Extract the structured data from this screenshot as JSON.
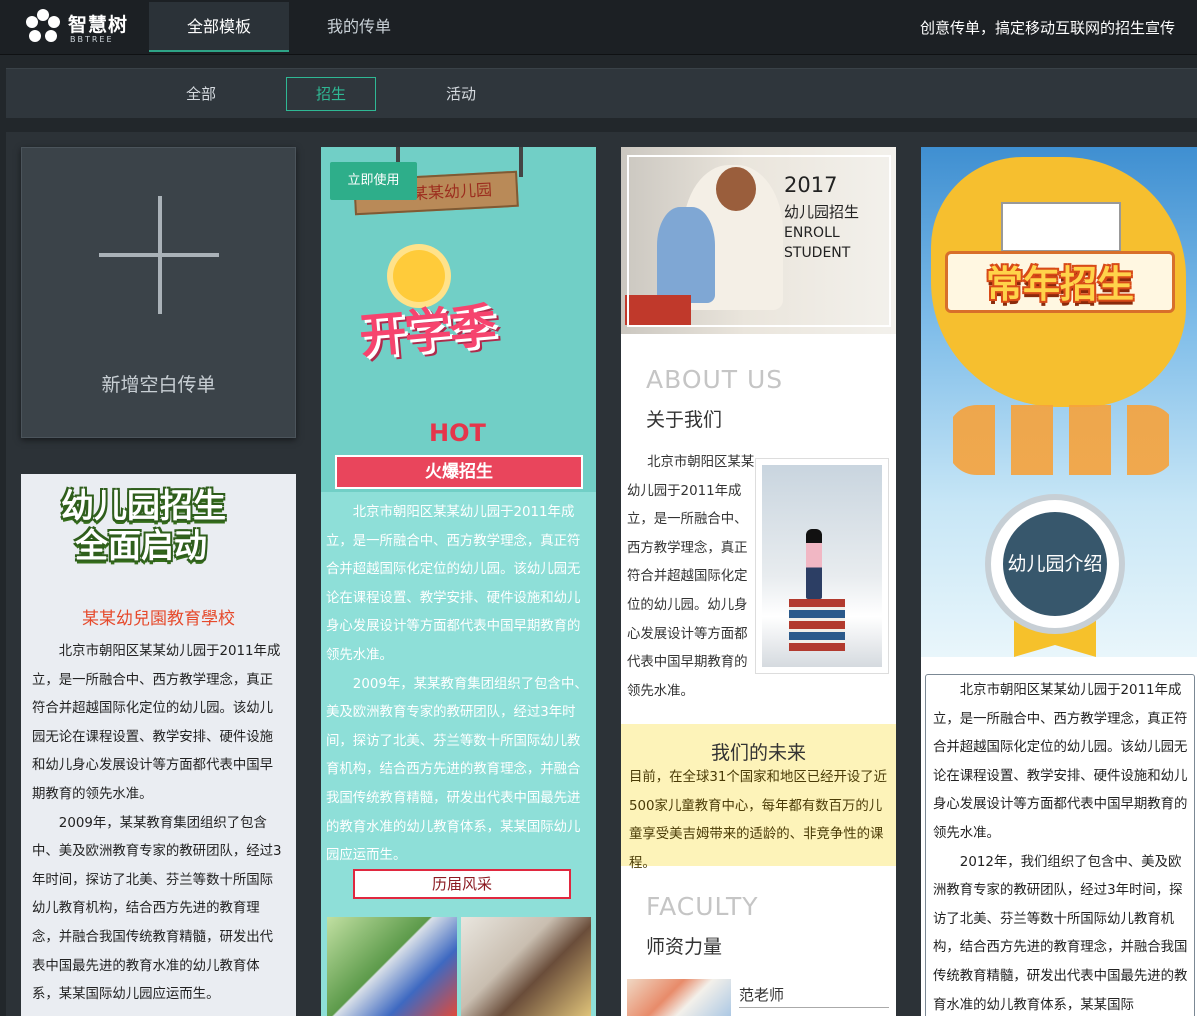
{
  "header": {
    "logo_name": "智慧树",
    "logo_sub": "BBTREE",
    "tabs": [
      "全部模板",
      "我的传单"
    ],
    "slogan": "创意传单，搞定移动互联网的招生宣传"
  },
  "filters": [
    "全部",
    "招生",
    "活动"
  ],
  "new_card": {
    "label": "新增空白传单"
  },
  "card1": {
    "banner_line1": "幼儿园招生",
    "banner_line2": "全面启动",
    "school": "某某幼兒園教育學校",
    "para1": "北京市朝阳区某某幼儿园于2011年成立，是一所融合中、西方教学理念，真正符合并超越国际化定位的幼儿园。该幼儿园无论在课程设置、教学安排、硬件设施和幼儿身心发展设计等方面都代表中国早期教育的领先水准。",
    "para2": "2009年，某某教育集团组织了包含中、美及欧洲教育专家的教研团队，经过3年时间，探访了北美、芬兰等数十所国际幼儿教育机构，结合西方先进的教育理念，并融合我国传统教育精髓，研发出代表中国最先进的教育水准的幼儿教育体系，某某国际幼儿园应运而生。"
  },
  "card2": {
    "use_button": "立即使用",
    "sign": "某某幼儿园",
    "title": "开学季",
    "hot": "HOT",
    "ribbon": "火爆招生",
    "para1": "北京市朝阳区某某幼儿园于2011年成立，是一所融合中、西方教学理念，真正符合并超越国际化定位的幼儿园。该幼儿园无论在课程设置、教学安排、硬件设施和幼儿身心发展设计等方面都代表中国早期教育的领先水准。",
    "para2": "2009年，某某教育集团组织了包含中、美及欧洲教育专家的教研团队，经过3年时间，探访了北美、芬兰等数十所国际幼儿教育机构，结合西方先进的教育理念，并融合我国传统教育精髓，研发出代表中国最先进的教育水准的幼儿教育体系，某某国际幼儿园应运而生。",
    "strip": "历届风采"
  },
  "card3": {
    "hero_year": "2017",
    "hero_line1": "幼儿园招生",
    "hero_line2": "ENROLL",
    "hero_line3": "STUDENT",
    "about_en": "ABOUT  US",
    "about_cn": "关于我们",
    "about_text": "北京市朝阳区某某幼儿园于2011年成立，是一所融合中、西方教学理念，真正符合并超越国际化定位的幼儿园。幼儿身心发展设计等方面都代表中国早期教育的领先水准。",
    "future_title": "我们的未来",
    "future_text": "目前，在全球31个国家和地区已经开设了近500家儿童教育中心，每年都有数百万的儿童享受美吉姆带来的适龄的、非竞争性的课程。",
    "faculty_en": "FACULTY",
    "faculty_cn": "师资力量",
    "teacher": "范老师"
  },
  "card4": {
    "title": "常年招生",
    "medal": "幼儿园介绍",
    "para1": "北京市朝阳区某某幼儿园于2011年成立，是一所融合中、西方教学理念，真正符合并超越国际化定位的幼儿园。该幼儿园无论在课程设置、教学安排、硬件设施和幼儿身心发展设计等方面都代表中国早期教育的领先水准。",
    "para2": "2012年，我们组织了包含中、美及欧洲教育专家的教研团队，经过3年时间，探访了北美、芬兰等数十所国际幼儿教育机构，结合西方先进的教育理念，并融合我国传统教育精髓，研发出代表中国最先进的教育水准的幼儿教育体系，某某国际"
  }
}
